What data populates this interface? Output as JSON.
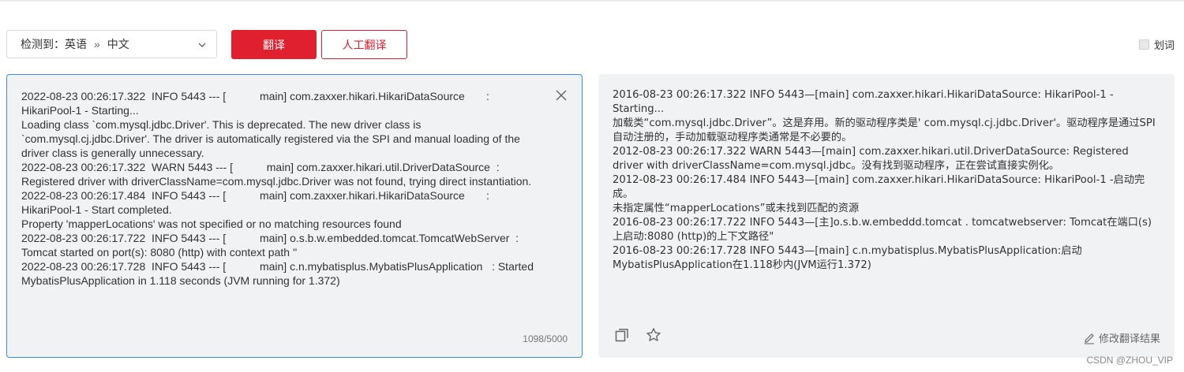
{
  "toolbar": {
    "detected_prefix": "检测到：英语",
    "separator": "»",
    "target_lang": "中文",
    "translate_label": "翻译",
    "human_translate_label": "人工翻译",
    "word_pick_label": "划词"
  },
  "source": {
    "text": "2022-08-23 00:26:17.322  INFO 5443 --- [           main] com.zaxxer.hikari.HikariDataSource       : HikariPool-1 - Starting...\nLoading class `com.mysql.jdbc.Driver'. This is deprecated. The new driver class is `com.mysql.cj.jdbc.Driver'. The driver is automatically registered via the SPI and manual loading of the driver class is generally unnecessary.\n2022-08-23 00:26:17.322  WARN 5443 --- [           main] com.zaxxer.hikari.util.DriverDataSource  : Registered driver with driverClassName=com.mysql.jdbc.Driver was not found, trying direct instantiation.\n2022-08-23 00:26:17.484  INFO 5443 --- [           main] com.zaxxer.hikari.HikariDataSource       : HikariPool-1 - Start completed.\nProperty 'mapperLocations' was not specified or no matching resources found\n2022-08-23 00:26:17.722  INFO 5443 --- [           main] o.s.b.w.embedded.tomcat.TomcatWebServer  : Tomcat started on port(s): 8080 (http) with context path ''\n2022-08-23 00:26:17.728  INFO 5443 --- [           main] c.n.mybatisplus.MybatisPlusApplication   : Started MybatisPlusApplication in 1.118 seconds (JVM running for 1.372)",
    "char_count": "1098/5000"
  },
  "result": {
    "text": "2016-08-23 00:26:17.322 INFO 5443—[main] com.zaxxer.hikari.HikariDataSource: HikariPool-1 - Starting...\n加载类“com.mysql.jdbc.Driver”。这是弃用。新的驱动程序类是' com.mysql.cj.jdbc.Driver'。驱动程序是通过SPI自动注册的，手动加载驱动程序类通常是不必要的。\n2012-08-23 00:26:17.322 WARN 5443—[main] com.zaxxer.hikari.util.DriverDataSource: Registered driver with driverClassName=com.mysql.jdbc。没有找到驱动程序，正在尝试直接实例化。\n2012-08-23 00:26:17.484 INFO 5443—[main] com.zaxxer.hikari.HikariDataSource: HikariPool-1 -启动完成。\n未指定属性“mapperLocations”或未找到匹配的资源\n2016-08-23 00:26:17.722 INFO 5443—[主]o.s.b.w.embeddd.tomcat . tomcatwebserver: Tomcat在端口(s)上启动:8080 (http)的上下文路径\"\n2016-08-23 00:26:17.728 INFO 5443—[main] c.n.mybatisplus.MybatisPlusApplication:启动MybatisPlusApplication在1.118秒内(JVM运行1.372)",
    "edit_label": "修改翻译结果"
  },
  "watermark": "CSDN @ZHOU_VIP",
  "colors": {
    "accent": "#e0202e",
    "focus_border": "#3c8ee0",
    "panel_bg": "#f1f2f4"
  },
  "icons": [
    "chevron-down-icon",
    "close-icon",
    "copy-icon",
    "star-icon",
    "pencil-icon"
  ]
}
